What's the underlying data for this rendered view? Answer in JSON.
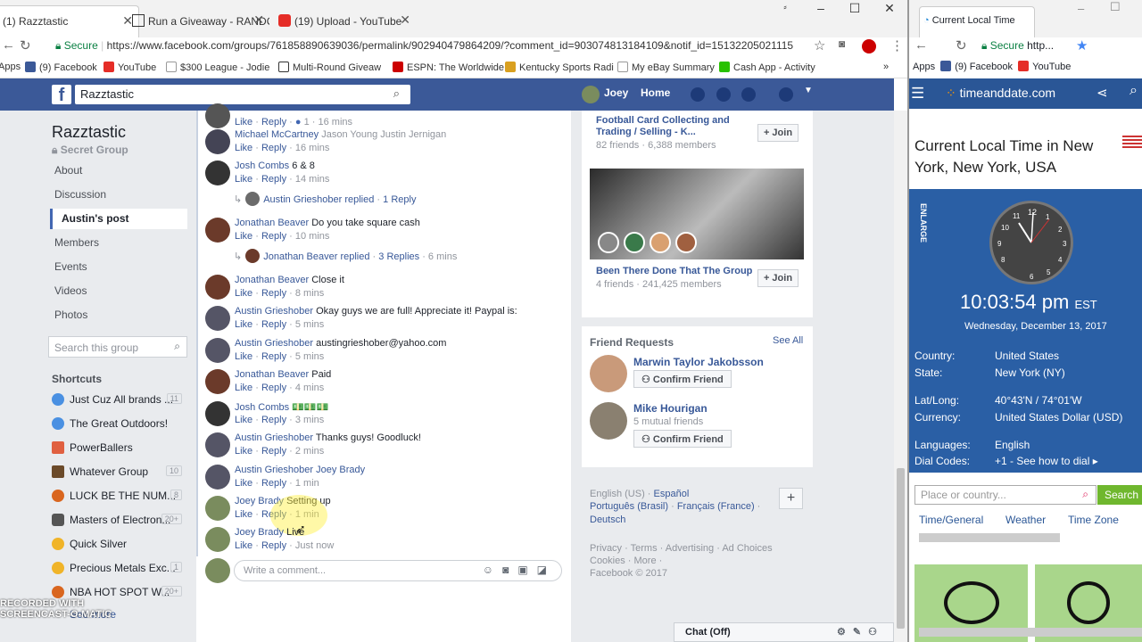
{
  "browser": {
    "tabs": [
      {
        "label": "(1) Razztastic"
      },
      {
        "label": "Run a Giveaway - RANDOM"
      },
      {
        "label": "(19) Upload - YouTube"
      }
    ],
    "secure_label": "Secure",
    "url": "https://www.facebook.com/groups/761858890639036/permalink/902940479864209/?comment_id=903074813184109&notif_id=15132205021115 79...",
    "bookmarks": [
      "Apps",
      "(9) Facebook",
      "YouTube",
      "$300 League - Jodie",
      "Multi-Round Giveaw",
      "ESPN: The Worldwide",
      "Kentucky Sports Radi",
      "My eBay Summary",
      "Cash App - Activity"
    ],
    "bookmarks_more": "»"
  },
  "fb": {
    "search_value": "Razztastic",
    "user": "Joey",
    "home": "Home"
  },
  "group": {
    "name": "Razztastic",
    "type": "Secret Group",
    "nav": [
      "About",
      "Discussion",
      "Austin's post",
      "Members",
      "Events",
      "Videos",
      "Photos"
    ],
    "search_placeholder": "Search this group",
    "shortcuts_title": "Shortcuts",
    "shortcuts": [
      {
        "label": "Just Cuz All brands ...",
        "count": "11"
      },
      {
        "label": "The Great Outdoors!",
        "count": ""
      },
      {
        "label": "PowerBallers",
        "count": ""
      },
      {
        "label": "Whatever Group",
        "count": "10"
      },
      {
        "label": "LUCK BE THE NUM...",
        "count": "8"
      },
      {
        "label": "Masters of Electron...",
        "count": "20+"
      },
      {
        "label": "Quick Silver",
        "count": ""
      },
      {
        "label": "Precious Metals Exc...",
        "count": "1"
      },
      {
        "label": "NBA HOT SPOT W...",
        "count": "20+"
      }
    ],
    "see_more": "See more"
  },
  "comments": [
    {
      "name": "",
      "text": "",
      "meta_like": "Like",
      "meta_reply": "Reply",
      "reactions": "1",
      "time": "16 mins"
    },
    {
      "name": "Michael McCartney",
      "text": "Jason Young  Justin Jernigan",
      "meta_like": "Like",
      "meta_reply": "Reply",
      "time": "16 mins"
    },
    {
      "name": "Josh Combs",
      "text": "6 & 8",
      "meta_like": "Like",
      "meta_reply": "Reply",
      "time": "14 mins"
    },
    {
      "name": "Jonathan Beaver",
      "text": "Do you take square cash",
      "meta_like": "Like",
      "meta_reply": "Reply",
      "time": "10 mins"
    },
    {
      "name": "Jonathan Beaver",
      "text": "Close it",
      "meta_like": "Like",
      "meta_reply": "Reply",
      "time": "8 mins"
    },
    {
      "name": "Austin Grieshober",
      "text": "Okay guys we are full! Appreciate it! Paypal is:",
      "meta_like": "Like",
      "meta_reply": "Reply",
      "time": "5 mins"
    },
    {
      "name": "Austin Grieshober",
      "text": "austingrieshober@yahoo.com",
      "meta_like": "Like",
      "meta_reply": "Reply",
      "time": "5 mins"
    },
    {
      "name": "Jonathan Beaver",
      "text": "Paid",
      "meta_like": "Like",
      "meta_reply": "Reply",
      "time": "4 mins"
    },
    {
      "name": "Josh Combs",
      "text": "💵💵💵",
      "meta_like": "Like",
      "meta_reply": "Reply",
      "time": "3 mins"
    },
    {
      "name": "Austin Grieshober",
      "text": "Thanks guys! Goodluck!",
      "meta_like": "Like",
      "meta_reply": "Reply",
      "time": "2 mins"
    },
    {
      "name": "Austin Grieshober",
      "text": "Joey Brady",
      "meta_like": "Like",
      "meta_reply": "Reply",
      "time": "1 min"
    },
    {
      "name": "Joey Brady",
      "text": "Setting up",
      "meta_like": "Like",
      "meta_reply": "Reply",
      "time": "1 min"
    },
    {
      "name": "Joey Brady",
      "text": "Live",
      "meta_like": "Like",
      "meta_reply": "Reply",
      "time": "Just now"
    }
  ],
  "replies": [
    {
      "who": "Austin Grieshober replied",
      "sep": "·",
      "count": "1 Reply"
    },
    {
      "who": "Jonathan Beaver replied",
      "sep": "·",
      "count": "3 Replies",
      "time": "6 mins"
    }
  ],
  "write_placeholder": "Write a comment...",
  "suggested": [
    {
      "name": "Football Card Collecting and Trading / Selling - K...",
      "stats": "82 friends · 6,388 members",
      "join": "+ Join"
    },
    {
      "name": "Been There Done That The Group",
      "stats": "4 friends · 241,425 members",
      "join": "+ Join"
    }
  ],
  "friend_requests": {
    "title": "Friend Requests",
    "see_all": "See All",
    "items": [
      {
        "name": "Marwin Taylor Jakobsson",
        "sub": "",
        "button": "Confirm Friend"
      },
      {
        "name": "Mike Hourigan",
        "sub": "5 mutual friends",
        "button": "Confirm Friend"
      }
    ]
  },
  "languages": {
    "line1a": "English (US)",
    "line1b": "Español",
    "line2a": "Português (Brasil)",
    "line2b": "Français (France)",
    "line3": "Deutsch",
    "plus": "+"
  },
  "footer": {
    "links1": "Privacy · Terms · Advertising · Ad Choices",
    "links2": "Cookies · More ·",
    "copy": "Facebook © 2017"
  },
  "chat": "Chat (Off)",
  "timeanddate": {
    "tab": "Current Local Time",
    "url": "http...",
    "secure": "Secure",
    "bookmarks": [
      "Apps",
      "(9) Facebook",
      "YouTube"
    ],
    "site": "timeanddate.com",
    "title": "Current Local Time in New York, New York, USA",
    "enlarge": "ENLARGE",
    "time": "10:03:54 pm",
    "tz": "EST",
    "date": "Wednesday, December 13, 2017",
    "rows": [
      {
        "k": "Country:",
        "v": "United States"
      },
      {
        "k": "State:",
        "v": "New York (NY)"
      },
      {
        "k": "Lat/Long:",
        "v": "40°43'N / 74°01'W"
      },
      {
        "k": "Currency:",
        "v": "United States Dollar (USD)"
      },
      {
        "k": "Languages:",
        "v": "English"
      },
      {
        "k": "Dial Codes:",
        "v": "+1 - See how to dial ▸"
      }
    ],
    "search_placeholder": "Place or country...",
    "search_btn": "Search",
    "tabs": [
      "Time/General",
      "Weather",
      "Time Zone"
    ]
  },
  "watermark": "RECORDED WITH SCREENCAST-O-MATIC"
}
